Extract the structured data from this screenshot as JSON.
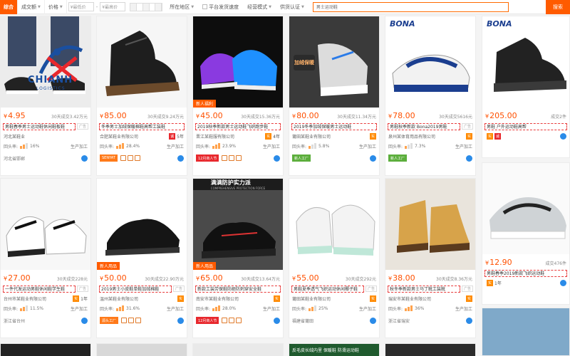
{
  "filters": {
    "tabs": [
      {
        "label": "综合",
        "active": true
      },
      {
        "label": "成交额",
        "active": false
      },
      {
        "label": "价格",
        "active": false
      }
    ],
    "price_min_placeholder": "¥最低价",
    "price_max_placeholder": "¥最高价",
    "location": "所在地区",
    "checks": [
      "平台发货速度",
      "经营模式",
      "供货认证"
    ],
    "search_value": "男士运动鞋",
    "search_button": "搜索"
  },
  "logo": {
    "text": "CHIANH",
    "subtext": "LOGISTICS"
  },
  "products": [
    {
      "price": "4.95",
      "deals": "30天成交3.42万元",
      "title": "男鞋春季男士运动鞋休闲鞋板鞋",
      "shop": "河北某鞋业",
      "year": "",
      "repeat": "16%",
      "mode": "生产加工",
      "tag": "",
      "bottom": "河北省邯郸"
    },
    {
      "price": "85.00",
      "deals": "30天成交9.24万元",
      "title": "冬季男士加绒保暖棉鞋高帮工装鞋",
      "shop": "合肥某鞋业有限公司",
      "year": "5年",
      "repeat": "28.4%",
      "mode": "生产加工",
      "tag": "",
      "bottom": "SENYAT"
    },
    {
      "price": "45.00",
      "deals": "30天成交15.36万元",
      "title": "2019秋季新款男士运动鞋飞织跑步鞋",
      "shop": "晋江某鞋服有限公司",
      "year": "4年",
      "repeat": "23.9%",
      "mode": "生产加工",
      "tag": "新人福利",
      "bottom": "12月商人节"
    },
    {
      "price": "80.00",
      "deals": "30天成交11.34万元",
      "title": "2019冬季加绒保暖男士运动鞋",
      "shop": "莆田某鞋业有限公司",
      "year": "",
      "repeat": "5.8%",
      "mode": "生产加工",
      "tag": "",
      "bottom": "新人工厂"
    },
    {
      "price": "78.00",
      "deals": "30天成交5616元",
      "title": "男鞋秋季新款 Bona2019男鞋",
      "shop": "泉州某体育用品有限公司",
      "year": "",
      "repeat": "7.3%",
      "mode": "生产加工",
      "tag": "",
      "bottom": "新人工厂"
    },
    {
      "price": "205.00",
      "deals": "成交2件",
      "title": "男鞋 户外运动鞋高帮",
      "shop": "",
      "year": "",
      "repeat": "",
      "mode": "",
      "tag": "",
      "bottom": ""
    },
    {
      "price": "27.00",
      "deals": "30天成交228元",
      "title": "一件代发运动男鞋休闲鞋学生鞋",
      "shop": "台州市某鞋业有限公司",
      "year": "1年",
      "repeat": "11.5%",
      "mode": "生产加工",
      "tag": "",
      "bottom": "浙江省台州"
    },
    {
      "price": "50.00",
      "deals": "30天成交22.90万元",
      "title": "2019男士小皮鞋单鞋加绒棉鞋",
      "shop": "温州某鞋业有限公司",
      "year": "",
      "repeat": "31.6%",
      "mode": "生产加工",
      "tag": "新人用品",
      "bottom": "源头工厂"
    },
    {
      "price": "65.00",
      "deals": "30天成交13.64万元",
      "title": "新款工装劳保鞋防砸防刺穿安全鞋",
      "shop": "南安市某鞋业有限公司",
      "year": "",
      "repeat": "28.0%",
      "mode": "生产加工",
      "tag": "新人用品",
      "bottom": "12月商人节"
    },
    {
      "price": "55.00",
      "deals": "30天成交292元",
      "title": "男鞋夏季透气飞织运动休闲椰子鞋",
      "shop": "莆田某鞋业有限公司",
      "year": "",
      "repeat": "25%",
      "mode": "生产加工",
      "tag": "",
      "bottom": "福建省莆田"
    },
    {
      "price": "38.00",
      "deals": "30天成交8.36万元",
      "title": "秋冬季新款男士马丁靴工装靴",
      "shop": "瑞安市某鞋业有限公司",
      "year": "",
      "repeat": "36%",
      "mode": "生产加工",
      "tag": "",
      "bottom": "浙江省瑞安"
    },
    {
      "price": "12.90",
      "deals": "成交476件",
      "title": "男鞋春季2019新款飞织运动鞋",
      "shop": "",
      "year": "1年",
      "repeat": "",
      "mode": "",
      "tag": "",
      "bottom": ""
    }
  ],
  "labels": {
    "ad": "广告",
    "repeat_label": "回头率:",
    "brand_bona": "BONA",
    "thermal": "加绒保暖",
    "protect": "满满防护实力派",
    "protect_sub": "COMPREHENSIVE PROTECTION FORCE",
    "bottom_partial": "反毛皮长绒内里 保暖鞋 防滑运动鞋"
  }
}
